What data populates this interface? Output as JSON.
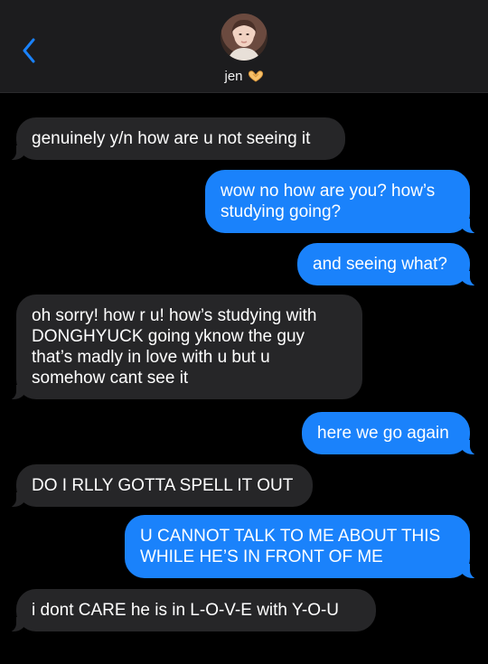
{
  "header": {
    "contact_name": "jen",
    "back_icon": "chevron-left-icon",
    "name_emoji": "heart-hands-icon",
    "accent_color": "#1a82fb"
  },
  "messages": [
    {
      "from": "them",
      "text": "genuinely y/n how are u not seeing it"
    },
    {
      "from": "me",
      "text": "wow no how are you? how’s studying going?"
    },
    {
      "from": "me",
      "text": "and seeing what?"
    },
    {
      "from": "them",
      "text": "oh sorry! how r u! how’s studying with DONGHYUCK going yknow the guy that’s madly in love with u but u somehow cant see it"
    },
    {
      "from": "me",
      "text": "here we go again"
    },
    {
      "from": "them",
      "text": "DO I RLLY GOTTA SPELL IT OUT"
    },
    {
      "from": "me",
      "text": "U CANNOT TALK TO ME ABOUT THIS WHILE HE’S IN FRONT OF ME"
    },
    {
      "from": "them",
      "text": "i dont CARE he is in L-O-V-E with Y-O-U"
    }
  ]
}
